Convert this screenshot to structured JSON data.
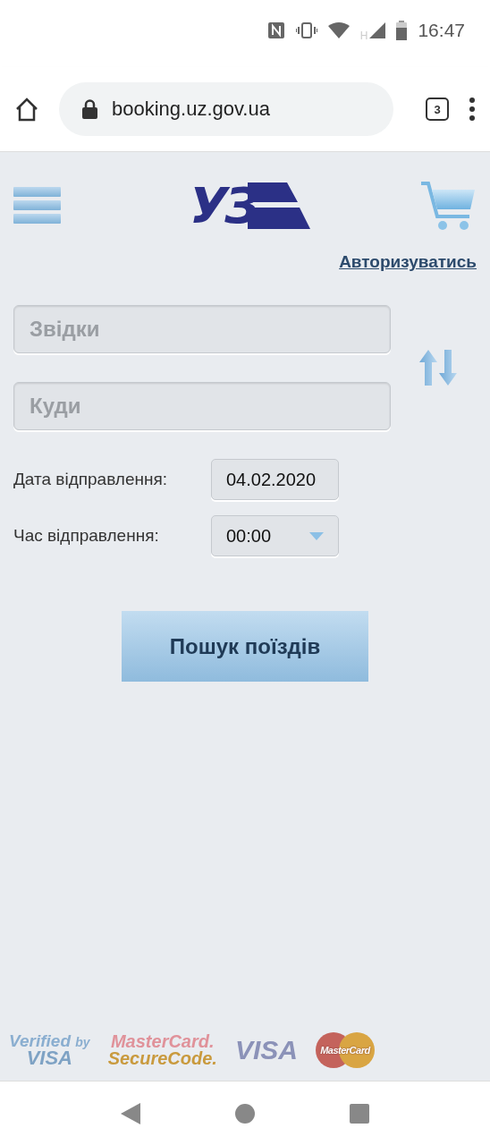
{
  "status_bar": {
    "network": "H",
    "time": "16:47"
  },
  "browser": {
    "url": "booking.uz.gov.ua",
    "tab_count": "3"
  },
  "header": {
    "logo": "УЗ"
  },
  "login_link": "Авторизуватись",
  "search_form": {
    "from": {
      "placeholder": "Звідки"
    },
    "to": {
      "placeholder": "Куди"
    },
    "date": {
      "label": "Дата відправлення:",
      "value": "04.02.2020"
    },
    "time": {
      "label": "Час відправлення:",
      "value": "00:00"
    },
    "submit": "Пошук поїздів"
  },
  "payment_logos": [
    {
      "kind": "verified",
      "lines": [
        "Verified",
        "by",
        "VISA"
      ]
    },
    {
      "kind": "securecode",
      "lines": [
        "MasterCard.",
        "SecureCode."
      ]
    },
    {
      "kind": "visa",
      "lines": [
        "VISA"
      ]
    },
    {
      "kind": "mastercard",
      "lines": [
        "MasterCard"
      ]
    }
  ]
}
